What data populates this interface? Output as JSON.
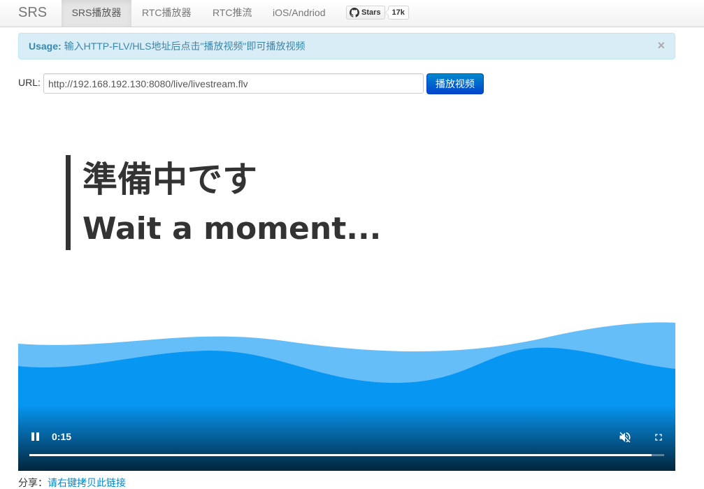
{
  "nav": {
    "brand": "SRS",
    "items": [
      {
        "label": "SRS播放器",
        "active": true
      },
      {
        "label": "RTC播放器",
        "active": false
      },
      {
        "label": "RTC推流",
        "active": false
      },
      {
        "label": "iOS/Andriod",
        "active": false
      }
    ],
    "github": {
      "icon": "github-icon",
      "label": "Stars",
      "count": "17k"
    }
  },
  "alert": {
    "title": "Usage:",
    "message": "输入HTTP-FLV/HLS地址后点击\"播放视频\"即可播放视频",
    "close": "×"
  },
  "url": {
    "label": "URL:",
    "value": "http://192.168.192.130:8080/live/livestream.flv",
    "button": "播放视频"
  },
  "video": {
    "title_jp": "準備中です",
    "title_en": "Wait a moment...",
    "time": "0:15",
    "progress": 0.98,
    "muted": true,
    "colors": {
      "wave_light": "#66bef9",
      "wave_dark": "#0796f2",
      "text": "#333333"
    }
  },
  "share": {
    "label": "分享：",
    "link": "请右键拷贝此链接"
  }
}
